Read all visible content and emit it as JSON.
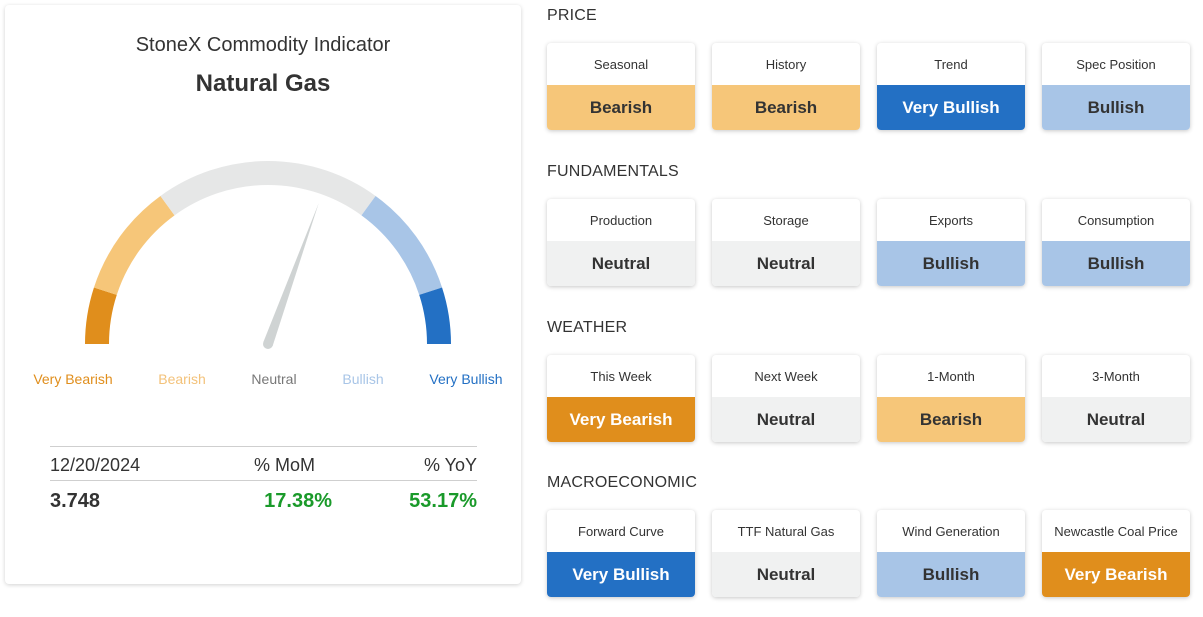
{
  "colors": {
    "very_bearish": "#e08e1c",
    "bearish": "#f6c679",
    "neutral": "#f0f1f1",
    "bullish": "#a8c5e7",
    "very_bullish": "#2370c4",
    "gauge_track": "#e6e7e7",
    "needle": "#cfd3d3",
    "positive": "#1a9a2a"
  },
  "gauge": {
    "title": "StoneX Commodity Indicator",
    "commodity": "Natural Gas",
    "needle_fraction": 0.61,
    "labels": [
      {
        "text": "Very Bearish",
        "color": "#e08e1c"
      },
      {
        "text": "Bearish",
        "color": "#f3c27a"
      },
      {
        "text": "Neutral",
        "color": "#777777"
      },
      {
        "text": "Bullish",
        "color": "#a8c5e7"
      },
      {
        "text": "Very Bullish",
        "color": "#2370c4"
      }
    ]
  },
  "stats": {
    "date": "12/20/2024",
    "mom_label": "% MoM",
    "yoy_label": "% YoY",
    "price": "3.748",
    "mom": "17.38%",
    "yoy": "53.17%"
  },
  "sections": [
    {
      "title": "PRICE",
      "tiles": [
        {
          "label": "Seasonal",
          "value": "Bearish",
          "level": "bearish"
        },
        {
          "label": "History",
          "value": "Bearish",
          "level": "bearish"
        },
        {
          "label": "Trend",
          "value": "Very Bullish",
          "level": "very_bullish"
        },
        {
          "label": "Spec Position",
          "value": "Bullish",
          "level": "bullish"
        }
      ]
    },
    {
      "title": "FUNDAMENTALS",
      "tiles": [
        {
          "label": "Production",
          "value": "Neutral",
          "level": "neutral"
        },
        {
          "label": "Storage",
          "value": "Neutral",
          "level": "neutral"
        },
        {
          "label": "Exports",
          "value": "Bullish",
          "level": "bullish"
        },
        {
          "label": "Consumption",
          "value": "Bullish",
          "level": "bullish"
        }
      ]
    },
    {
      "title": "WEATHER",
      "tiles": [
        {
          "label": "This Week",
          "value": "Very Bearish",
          "level": "very_bearish"
        },
        {
          "label": "Next Week",
          "value": "Neutral",
          "level": "neutral"
        },
        {
          "label": "1-Month",
          "value": "Bearish",
          "level": "bearish"
        },
        {
          "label": "3-Month",
          "value": "Neutral",
          "level": "neutral"
        }
      ]
    },
    {
      "title": "MACROECONOMIC",
      "tiles": [
        {
          "label": "Forward Curve",
          "value": "Very Bullish",
          "level": "very_bullish"
        },
        {
          "label": "TTF Natural Gas",
          "value": "Neutral",
          "level": "neutral"
        },
        {
          "label": "Wind Generation",
          "value": "Bullish",
          "level": "bullish"
        },
        {
          "label": "Newcastle Coal Price",
          "value": "Very Bearish",
          "level": "very_bearish"
        }
      ]
    }
  ]
}
